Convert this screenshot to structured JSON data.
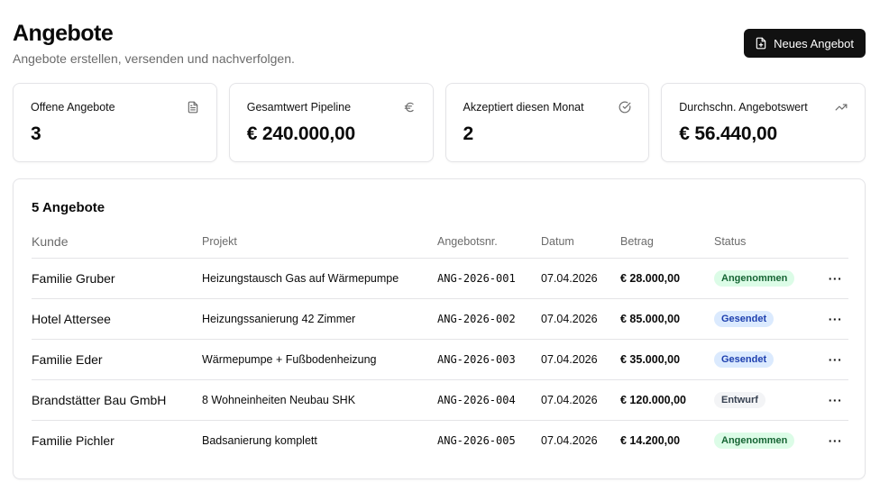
{
  "header": {
    "title": "Angebote",
    "subtitle": "Angebote erstellen, versenden und nachverfolgen.",
    "new_button_label": "Neues Angebot"
  },
  "stats": [
    {
      "label": "Offene Angebote",
      "value": "3",
      "icon": "document-icon"
    },
    {
      "label": "Gesamtwert Pipeline",
      "value": "€ 240.000,00",
      "icon": "euro-icon"
    },
    {
      "label": "Akzeptiert diesen Monat",
      "value": "2",
      "icon": "check-circle-icon"
    },
    {
      "label": "Durchschn. Angebotswert",
      "value": "€ 56.440,00",
      "icon": "trending-up-icon"
    }
  ],
  "table": {
    "title": "5 Angebote",
    "columns": [
      "Kunde",
      "Projekt",
      "Angebotsnr.",
      "Datum",
      "Betrag",
      "Status"
    ],
    "rows": [
      {
        "kunde": "Familie Gruber",
        "projekt": "Heizungstausch Gas auf Wärmepumpe",
        "nr": "ANG-2026-001",
        "datum": "07.04.2026",
        "betrag": "€ 28.000,00",
        "status": "Angenommen",
        "actions": "···"
      },
      {
        "kunde": "Hotel Attersee",
        "projekt": "Heizungssanierung 42 Zimmer",
        "nr": "ANG-2026-002",
        "datum": "07.04.2026",
        "betrag": "€ 85.000,00",
        "status": "Gesendet",
        "actions": "···"
      },
      {
        "kunde": "Familie Eder",
        "projekt": "Wärmepumpe + Fußbodenheizung",
        "nr": "ANG-2026-003",
        "datum": "07.04.2026",
        "betrag": "€ 35.000,00",
        "status": "Gesendet",
        "actions": "···"
      },
      {
        "kunde": "Brandstätter Bau GmbH",
        "projekt": "8 Wohneinheiten Neubau SHK",
        "nr": "ANG-2026-004",
        "datum": "07.04.2026",
        "betrag": "€ 120.000,00",
        "status": "Entwurf",
        "actions": "···"
      },
      {
        "kunde": "Familie Pichler",
        "projekt": "Badsanierung komplett",
        "nr": "ANG-2026-005",
        "datum": "07.04.2026",
        "betrag": "€ 14.200,00",
        "status": "Angenommen",
        "actions": "···"
      }
    ]
  },
  "status_colors": {
    "Angenommen": {
      "bg": "#dcfce7",
      "fg": "#166534"
    },
    "Gesendet": {
      "bg": "#dbeafe",
      "fg": "#1e40af"
    },
    "Entwurf": {
      "bg": "#f3f4f6",
      "fg": "#374151"
    }
  },
  "accent": "#111111"
}
